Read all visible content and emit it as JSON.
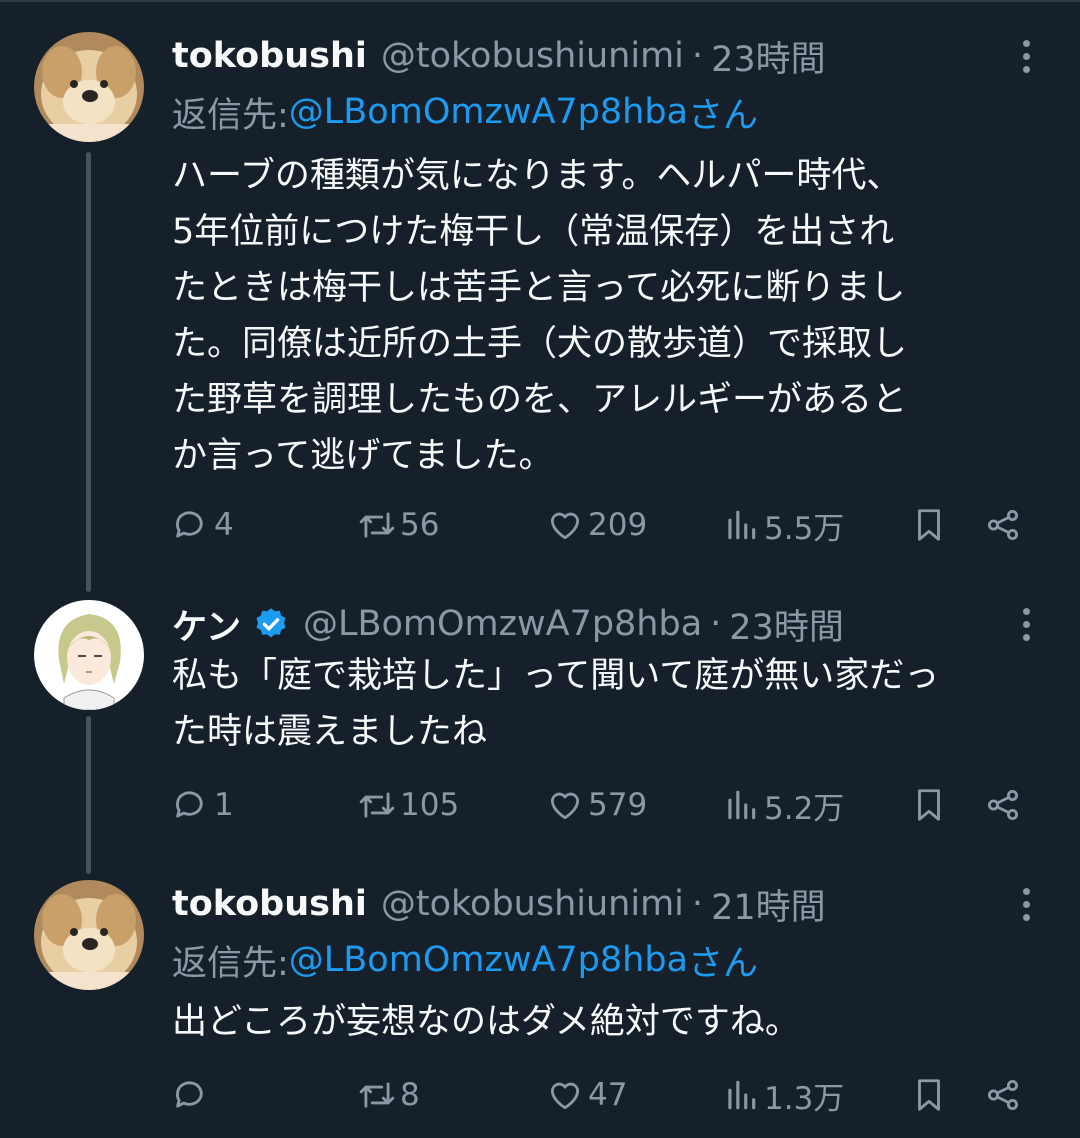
{
  "tweets": [
    {
      "name": "tokobushi",
      "handle": "@tokobushiunimi",
      "time": "23時間",
      "reply_prefix": "返信先: ",
      "reply_to": "@LBomOmzwA7p8hba",
      "reply_suffix": "さん",
      "text": "ハーブの種類が気になります。ヘルパー時代、\n5年位前につけた梅干し（常温保存）を出され\nたときは梅干しは苦手と言って必死に断りまし\nた。同僚は近所の土手（犬の散歩道）で採取し\nた野草を調理したものを、アレルギーがあると\nか言って逃げてました。",
      "replies": "4",
      "retweets": "56",
      "likes": "209",
      "views": "5.5万"
    },
    {
      "name": "ケン",
      "handle": "@LBomOmzwA7p8hba",
      "time": "23時間",
      "verified": true,
      "text": "私も「庭で栽培した」って聞いて庭が無い家だっ\nた時は震えましたね",
      "replies": "1",
      "retweets": "105",
      "likes": "579",
      "views": "5.2万"
    },
    {
      "name": "tokobushi",
      "handle": "@tokobushiunimi",
      "time": "21時間",
      "reply_prefix": "返信先: ",
      "reply_to": "@LBomOmzwA7p8hba",
      "reply_suffix": "さん",
      "text": "出どころが妄想なのはダメ絶対ですね。",
      "replies": "",
      "retweets": "8",
      "likes": "47",
      "views": "1.3万"
    }
  ],
  "colors": {
    "background": "#15202b",
    "text": "#f7f9f9",
    "secondary": "#8b98a5",
    "accent": "#1d9bf0"
  },
  "icons": [
    "reply-icon",
    "retweet-icon",
    "like-icon",
    "views-icon",
    "bookmark-icon",
    "share-icon",
    "more-icon",
    "verified-icon"
  ]
}
